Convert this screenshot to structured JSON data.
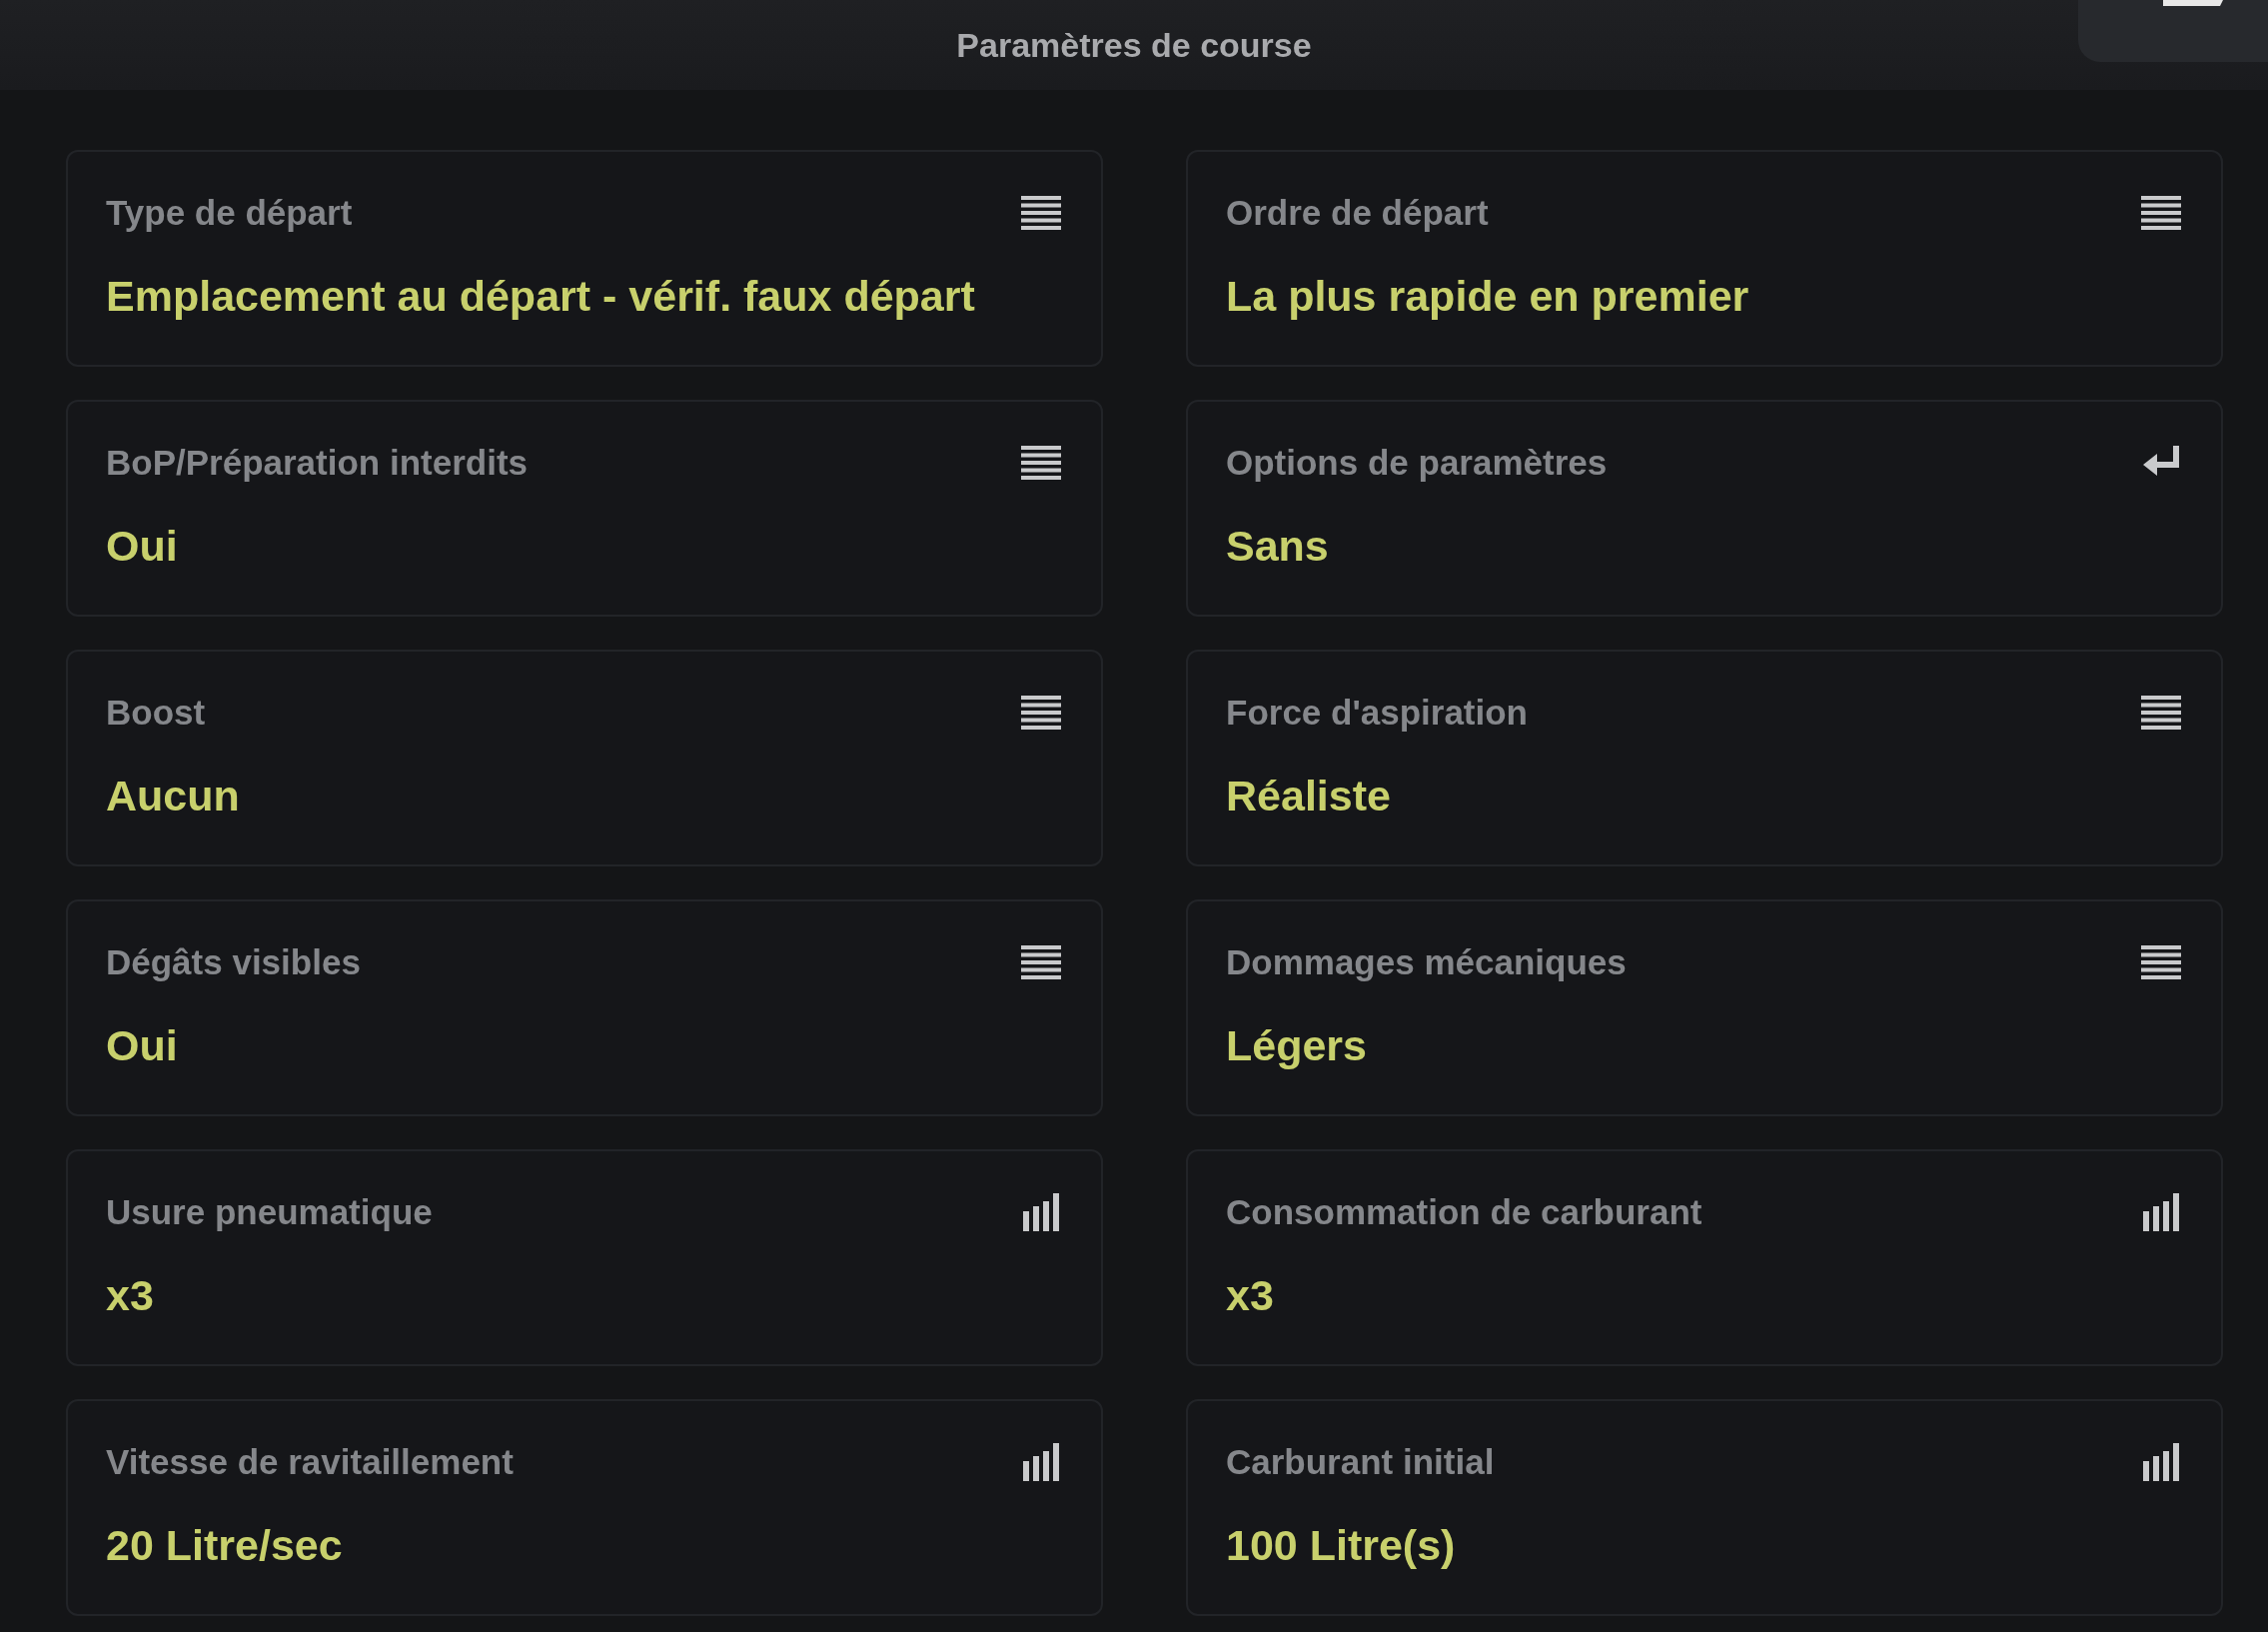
{
  "header": {
    "title": "Paramètres de course"
  },
  "settings": [
    {
      "label": "Type de départ",
      "value": "Emplacement au départ - vérif. faux départ",
      "kind": "list"
    },
    {
      "label": "Ordre de départ",
      "value": "La plus rapide en premier",
      "kind": "list"
    },
    {
      "label": "BoP/Préparation interdits",
      "value": "Oui",
      "kind": "list"
    },
    {
      "label": "Options de paramètres",
      "value": "Sans",
      "kind": "enter"
    },
    {
      "label": "Boost",
      "value": "Aucun",
      "kind": "list"
    },
    {
      "label": "Force d'aspiration",
      "value": "Réaliste",
      "kind": "list"
    },
    {
      "label": "Dégâts visibles",
      "value": "Oui",
      "kind": "list"
    },
    {
      "label": "Dommages mécaniques",
      "value": "Légers",
      "kind": "list"
    },
    {
      "label": "Usure pneumatique",
      "value": "x3",
      "kind": "level"
    },
    {
      "label": "Consommation de carburant",
      "value": "x3",
      "kind": "level"
    },
    {
      "label": "Vitesse de ravitaillement",
      "value": "20 Litre/sec",
      "kind": "level"
    },
    {
      "label": "Carburant initial",
      "value": "100 Litre(s)",
      "kind": "level"
    }
  ]
}
